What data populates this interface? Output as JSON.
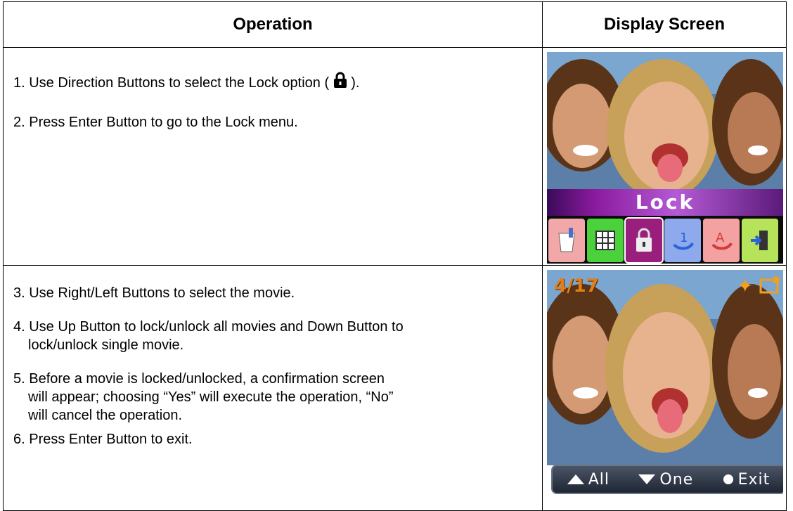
{
  "table": {
    "headers": [
      "Operation",
      "Display Screen"
    ],
    "row1": {
      "step1_before": "1. Use Direction Buttons to select the Lock option (",
      "step1_after": ").",
      "step2": "2. Press Enter Button to go to the Lock menu."
    },
    "row2": {
      "step3": "3. Use Right/Left Buttons to select the movie.",
      "step4_line1": "4. Use Up Button to lock/unlock all movies and Down Button to",
      "step4_line2": "lock/unlock single movie.",
      "step5_line1": "5. Before a movie is locked/unlocked, a confirmation screen",
      "step5_line2": "will appear; choosing “Yes” will execute the operation, “No”",
      "step5_line3": "will cancel the operation.",
      "step6": "6. Press Enter Button to exit."
    }
  },
  "screen1": {
    "menu_label": "Lock",
    "icons": [
      "delete-icon",
      "thumbnail-icon",
      "lock-icon",
      "rotate-icon",
      "autoplay-icon",
      "exit-icon"
    ],
    "icon_colors": [
      "#f2a7a9",
      "#4bd13b",
      "#9a1f7c",
      "#8ea9ec",
      "#f4a1a1",
      "#b6e35a"
    ]
  },
  "screen2": {
    "counter": "4/17",
    "nav": {
      "all": "All",
      "one": "One",
      "exit": "Exit"
    }
  }
}
